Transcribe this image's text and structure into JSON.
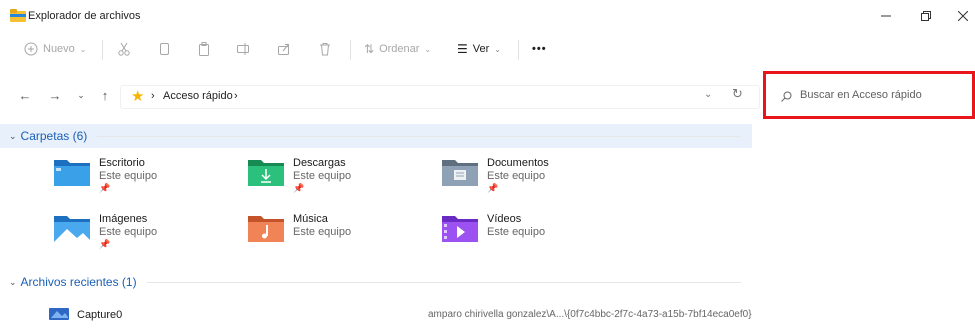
{
  "window": {
    "title": "Explorador de archivos"
  },
  "toolbar": {
    "new_label": "Nuevo",
    "sort_label": "Ordenar",
    "view_label": "Ver",
    "more_label": "•••"
  },
  "address": {
    "crumb": "Acceso rápido"
  },
  "search": {
    "placeholder": "Buscar en Acceso rápido"
  },
  "groups": {
    "folders": {
      "heading": "Carpetas (6)"
    },
    "recent": {
      "heading": "Archivos recientes (1)"
    }
  },
  "folders": [
    {
      "name": "Escritorio",
      "location": "Este equipo",
      "pinned": true,
      "icon": "desktop-folder-icon",
      "color": "#2a86d9"
    },
    {
      "name": "Descargas",
      "location": "Este equipo",
      "pinned": true,
      "icon": "downloads-folder-icon",
      "color": "#23a86b"
    },
    {
      "name": "Documentos",
      "location": "Este equipo",
      "pinned": true,
      "icon": "documents-folder-icon",
      "color": "#7c8d9e"
    },
    {
      "name": "Imágenes",
      "location": "Este equipo",
      "pinned": true,
      "icon": "pictures-folder-icon",
      "color": "#2b8fdb"
    },
    {
      "name": "Música",
      "location": "Este equipo",
      "pinned": false,
      "icon": "music-folder-icon",
      "color": "#e06a3a"
    },
    {
      "name": "Vídeos",
      "location": "Este equipo",
      "pinned": false,
      "icon": "videos-folder-icon",
      "color": "#8a3ee0"
    }
  ],
  "recent_files": [
    {
      "name": "Capture0",
      "path": "amparo chirivella gonzalez\\A...\\{0f7c4bbc-2f7c-4a73-a15b-7bf14eca0ef0}"
    }
  ],
  "colors": {
    "highlight": "#e8f0fb",
    "accent": "#1a5fb4",
    "search_outline": "#e8161b"
  }
}
